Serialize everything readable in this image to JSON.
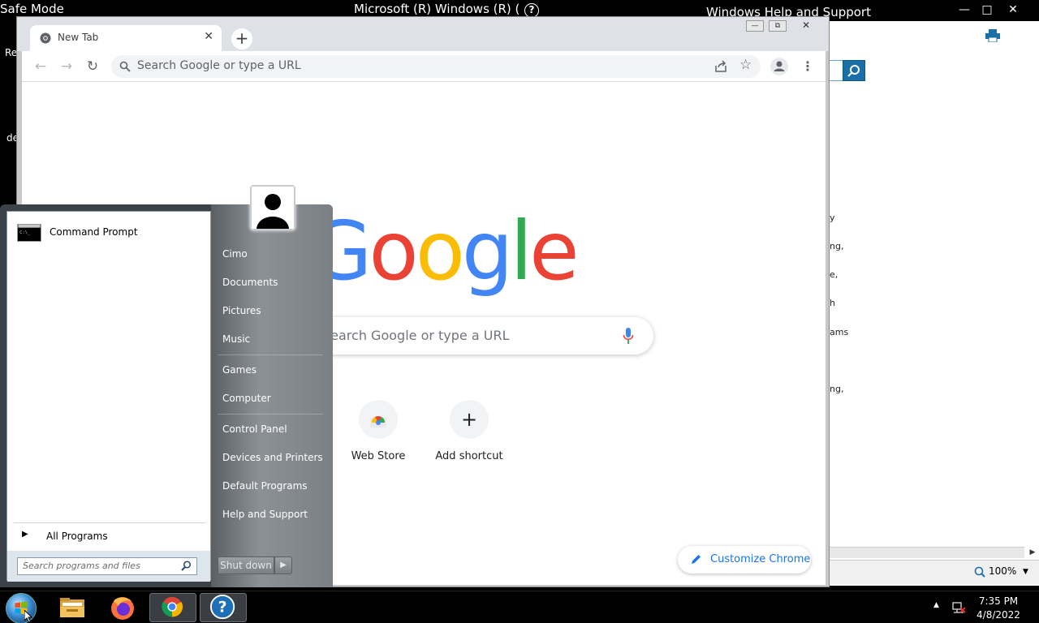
{
  "desktop": {
    "safe_mode": "Safe Mode",
    "window_title": "Microsoft (R) Windows (R) (Bui",
    "icon_label_1": "Re",
    "icon_label_2": "de"
  },
  "help_window": {
    "title": "Windows Help and Support",
    "zoom": "100%",
    "snippets": [
      "y",
      "ng,",
      "e,",
      "h",
      "ams",
      "ng,"
    ]
  },
  "chrome": {
    "tab_title": "New Tab",
    "new_tab": "+",
    "omnibox_placeholder": "Search Google or type a URL",
    "logo": [
      "G",
      "o",
      "o",
      "g",
      "l",
      "e"
    ],
    "logo_colors": [
      "#4285f4",
      "#ea4335",
      "#fbbc05",
      "#4285f4",
      "#34a853",
      "#ea4335"
    ],
    "search_placeholder": "Search Google or type a URL",
    "shortcuts": [
      {
        "label": "Web Store",
        "icon": "web-store-icon"
      },
      {
        "label": "Add shortcut",
        "icon": "plus-icon",
        "glyph": "+"
      }
    ],
    "customize_label": "Customize Chrome"
  },
  "start_menu": {
    "pinned": [
      {
        "label": "Command Prompt",
        "icon": "cmd-icon"
      }
    ],
    "all_programs": "All Programs",
    "search_placeholder": "Search programs and files",
    "links": [
      "Cimo",
      "Documents",
      "Pictures",
      "Music",
      "Games",
      "Computer",
      "Control Panel",
      "Devices and Printers",
      "Default Programs",
      "Help and Support"
    ],
    "shutdown": "Shut down"
  },
  "taskbar": {
    "apps": [
      "file-explorer-icon",
      "firefox-icon",
      "chrome-icon",
      "help-support-icon"
    ],
    "time": "7:35 PM",
    "date": "4/8/2022"
  }
}
